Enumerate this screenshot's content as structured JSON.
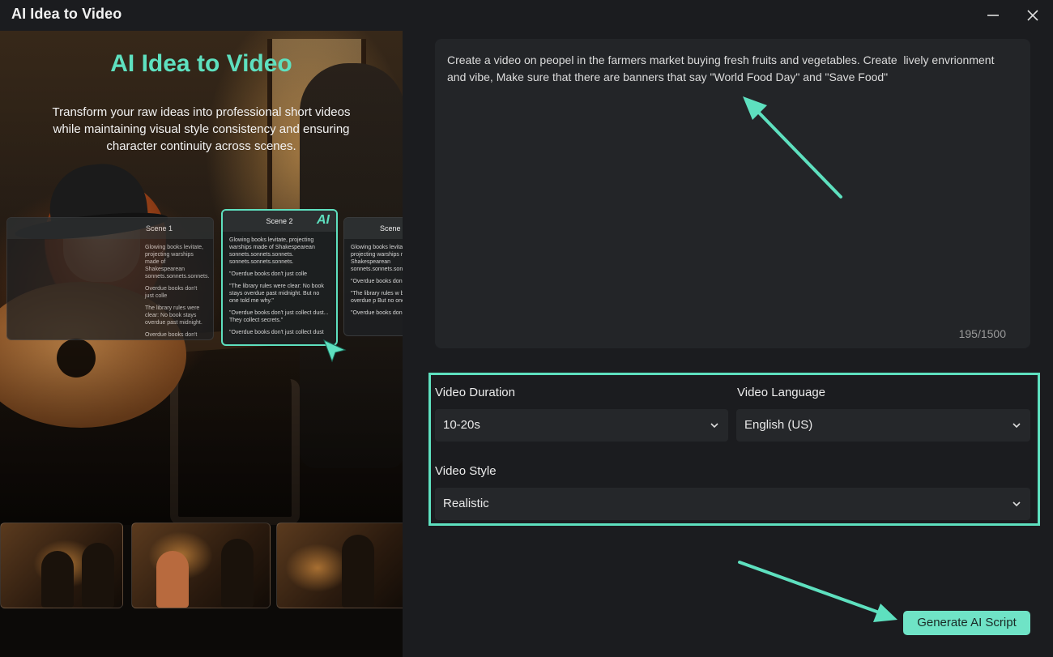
{
  "window": {
    "title": "AI Idea to Video",
    "icons": {
      "minimize": "minimize-icon",
      "close": "close-icon"
    }
  },
  "hero": {
    "title": "AI Idea to Video",
    "subtitle": "Transform your raw ideas into professional short videos while maintaining visual style consistency and ensuring character continuity across scenes.",
    "ai_badge": "AI",
    "scene_cards": [
      {
        "title": "Scene 1",
        "lines": [
          "Glowing books levitate, projecting warships made of Shakespearean sonnets.sonnets.sonnets.",
          "Overdue books don't just colle",
          "The library rules were clear: No book stays overdue past midnight.",
          "Overdue books don't just collect dust"
        ]
      },
      {
        "title": "Scene 2",
        "lines": [
          "Glowing books levitate, projecting warships made of Shakespearean sonnets.sonnets.sonnets. sonnets.sonnets.sonnets.",
          "\"Overdue books don't just colle",
          "\"The library rules were clear: No book stays overdue past midnight. But no one told me why.\"",
          "\"Overdue books don't just collect dust... They collect secrets.\"",
          "\"Overdue books don't just collect dust"
        ]
      },
      {
        "title": "Scene",
        "lines": [
          "Glowing books levitate, projecting warships made of Shakespearean sonnets.sonnets.sonnets.",
          "\"Overdue books don't",
          "\"The library rules w book stays overdue p But no one told me w",
          "\"Overdue books don't"
        ]
      }
    ]
  },
  "prompt": {
    "text": "Create a video on peopel in the farmers market buying fresh fruits and vegetables. Create  lively envrionment and vibe, Make sure that there are banners that say \"World Food Day\" and \"Save Food\"",
    "char_count": "195/1500"
  },
  "options": {
    "duration": {
      "label": "Video Duration",
      "value": "10-20s"
    },
    "language": {
      "label": "Video Language",
      "value": "English (US)"
    },
    "style": {
      "label": "Video Style",
      "value": "Realistic"
    }
  },
  "actions": {
    "generate_label": "Generate AI Script"
  },
  "colors": {
    "accent": "#5ee0bf",
    "button": "#6fe3c6",
    "background": "#1b1c1f",
    "panel": "#232528"
  }
}
